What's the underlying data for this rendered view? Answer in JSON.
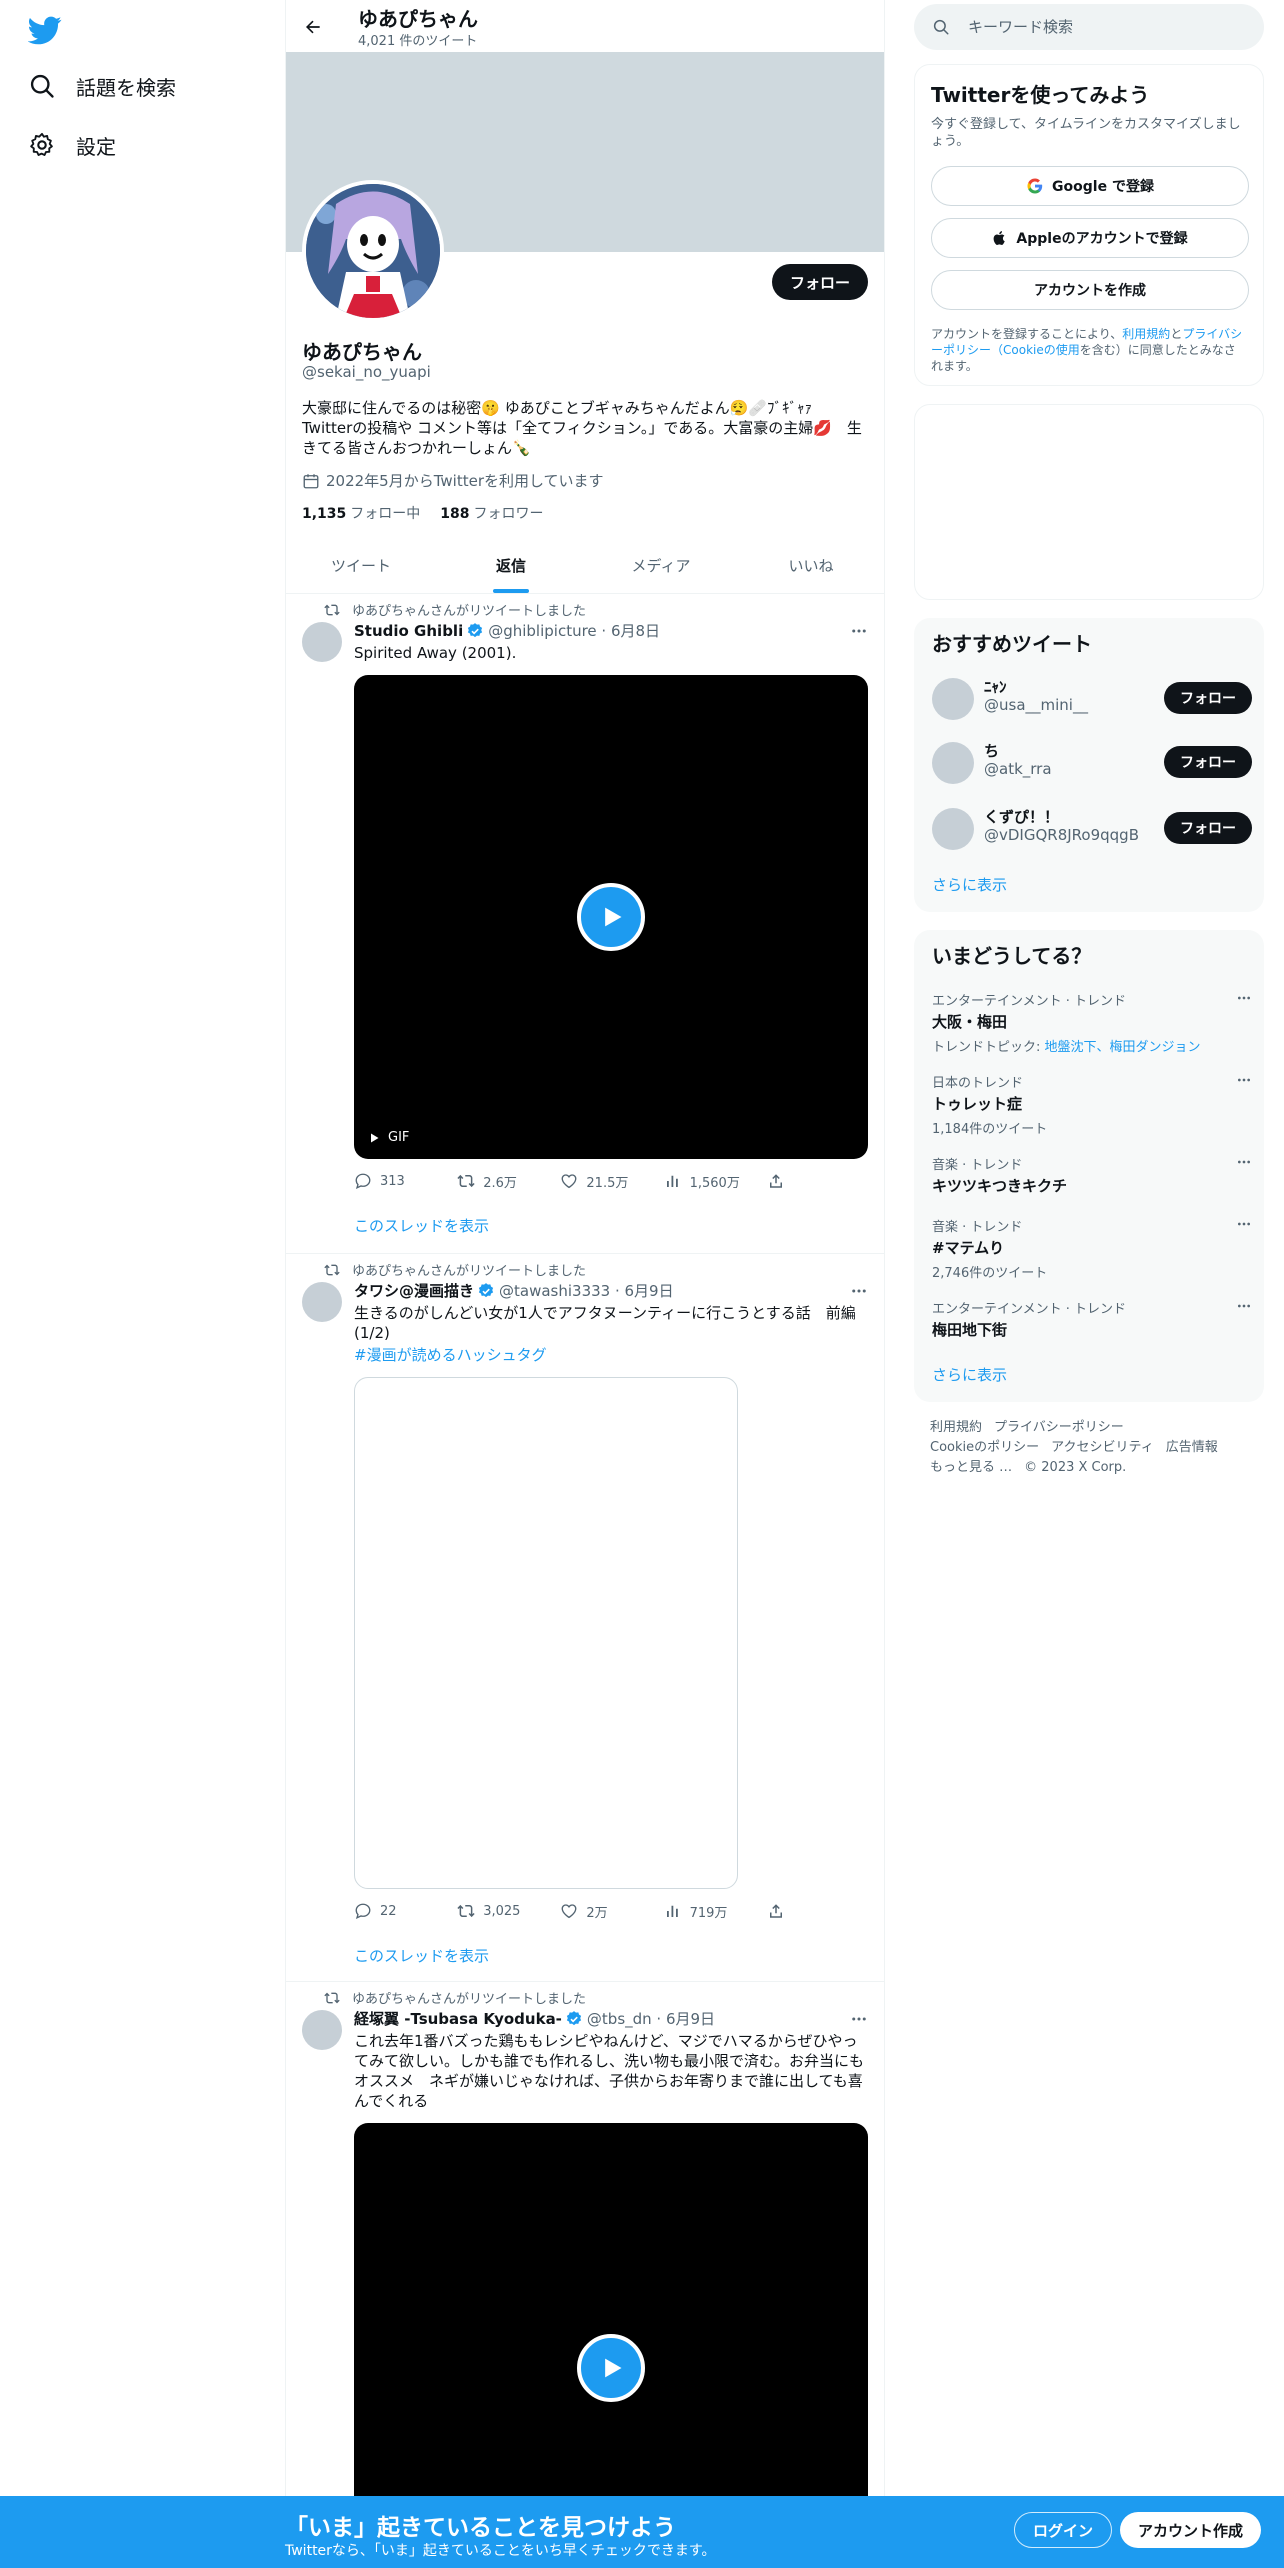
{
  "nav": {
    "explore_label": "話題を検索",
    "settings_label": "設定"
  },
  "header": {
    "name": "ゆあぴちゃん",
    "tweet_count": "4,021 件のツイート"
  },
  "profile": {
    "follow_label": "フォロー",
    "name": "ゆあぴちゃん",
    "handle": "@sekai_no_yuapi",
    "bio_line1": "大豪邸に住んでるのは秘密🤫 ゆあぴことブギャみちゃんだよん😮‍💨🩹ﾌﾞｷﾞｬｧ",
    "bio_line2": "Twitterの投稿や コメント等は「全てフィクション。」である。大富豪の主婦💋　生きてる皆さんおつかれーしょん🍾",
    "joined": "2022年5月からTwitterを利用しています",
    "following_count": "1,135",
    "following_label": "フォロー中",
    "followers_count": "188",
    "followers_label": "フォロワー"
  },
  "tabs": [
    {
      "label": "ツイート"
    },
    {
      "label": "返信"
    },
    {
      "label": "メディア"
    },
    {
      "label": "いいね"
    }
  ],
  "tweets": [
    {
      "retweet_by": "ゆあぴちゃんさんがリツイートしました",
      "name": "Studio Ghibli",
      "handle": "@ghiblipicture · 6月8日",
      "text": "Spirited Away (2001).",
      "hashtag": "",
      "media_badge": "GIF",
      "replies": "313",
      "retweets": "2.6万",
      "likes": "21.5万",
      "views": "1,560万",
      "thread": "このスレッドを表示"
    },
    {
      "retweet_by": "ゆあぴちゃんさんがリツイートしました",
      "name": "タワシ@漫画描き",
      "handle": "@tawashi3333 · 6月9日",
      "text": "生きるのがしんどい女が1人でアフタヌーンティーに行こうとする話　前編(1/2)",
      "hashtag": "#漫画が読めるハッシュタグ",
      "replies": "22",
      "retweets": "3,025",
      "likes": "2万",
      "views": "719万",
      "thread": "このスレッドを表示"
    },
    {
      "retweet_by": "ゆあぴちゃんさんがリツイートしました",
      "name": "経塚翼 -Tsubasa Kyoduka-",
      "handle": "@tbs_dn · 6月9日",
      "text": "これ去年1番バズった鶏ももレシピやねんけど、マジでハマるからぜひやってみて欲しい。しかも誰でも作れるし、洗い物も最小限で済む。お弁当にもオススメ　ネギが嫌いじゃなければ、子供からお年寄りまで誰に出しても喜んでくれる"
    }
  ],
  "search": {
    "placeholder": "キーワード検索"
  },
  "signup": {
    "title": "Twitterを使ってみよう",
    "subtitle": "今すぐ登録して、タイムラインをカスタマイズしましょう。",
    "google_label": "Google で登録",
    "apple_label": "Appleのアカウントで登録",
    "create_label": "アカウントを作成",
    "terms_prefix": "アカウントを登録することにより、",
    "terms_link1": "利用規約",
    "terms_and": "と",
    "terms_link2": "プライバシーポリシー（Cookieの使用",
    "terms_suffix": "を含む）に同意したとみなされます。"
  },
  "recommended": {
    "title": "おすすめツイート",
    "users": [
      {
        "name": "ﾆｬﾝ",
        "handle": "@usa__mini__",
        "follow": "フォロー"
      },
      {
        "name": "ち",
        "handle": "@atk_rra",
        "follow": "フォロー"
      },
      {
        "name": "くずぴ！！",
        "handle": "@vDIGQR8JRo9qqgB",
        "follow": "フォロー"
      }
    ],
    "show_more": "さらに表示"
  },
  "trends": {
    "title": "いまどうしてる？",
    "items": [
      {
        "context": "エンターテインメント · トレンド",
        "name": "大阪・梅田",
        "meta_prefix": "トレンドトピック: ",
        "meta_links": "地盤沈下、梅田ダンジョン"
      },
      {
        "context": "日本のトレンド",
        "name": "トゥレット症",
        "meta": "1,184件のツイート"
      },
      {
        "context": "音楽 · トレンド",
        "name": "キツツキつきキクチ"
      },
      {
        "context": "音楽 · トレンド",
        "name": "#マテムり",
        "meta": "2,746件のツイート"
      },
      {
        "context": "エンターテインメント · トレンド",
        "name": "梅田地下街"
      }
    ],
    "show_more": "さらに表示"
  },
  "footer": {
    "terms": "利用規約",
    "privacy": "プライバシーポリシー",
    "cookie": "Cookieのポリシー",
    "accessibility": "アクセシビリティ",
    "ads": "広告情報",
    "more": "もっと見る …",
    "copyright": "© 2023 X Corp."
  },
  "bottom_bar": {
    "title": "「いま」起きていることを見つけよう",
    "subtitle": "Twitterなら、「いま」起きていることをいち早くチェックできます。",
    "login_label": "ログイン",
    "signup_label": "アカウント作成"
  },
  "colors": {
    "accent": "#1d9bf0",
    "text": "#0f1419",
    "muted": "#536471",
    "banner": "#cfd9de"
  }
}
